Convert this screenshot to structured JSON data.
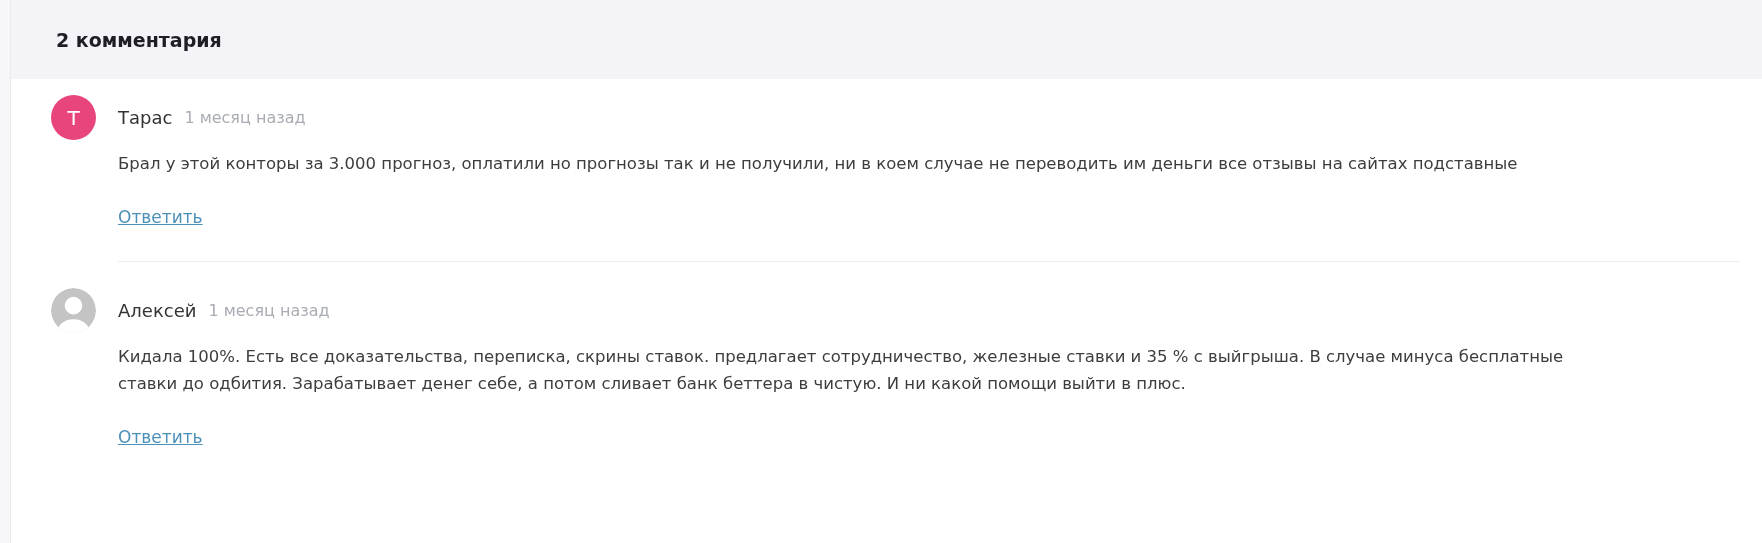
{
  "header": {
    "title": "2 комментария"
  },
  "comments": [
    {
      "avatar": {
        "kind": "letter",
        "letter": "Т",
        "color": "#e8457c"
      },
      "author": "Тарас",
      "time": "1 месяц назад",
      "text": "Брал у этой конторы за 3.000 прогноз, оплатили но прогнозы так и не получили, ни в коем случае не переводить им деньги все отзывы на сайтах подставные",
      "reply": "Ответить"
    },
    {
      "avatar": {
        "kind": "default"
      },
      "author": "Алексей",
      "time": "1 месяц назад",
      "text": "Кидала 100%. Есть все доказательства, переписка, скрины ставок. предлагает сотрудничество, железные ставки и 35 % с выйгрыша. В случае минуса бесплатные ставки до одбития. Зарабатывает денег себе, а потом сливает банк беттера в чистую. И ни какой помощи выйти в плюс.",
      "reply": "Ответить"
    }
  ]
}
